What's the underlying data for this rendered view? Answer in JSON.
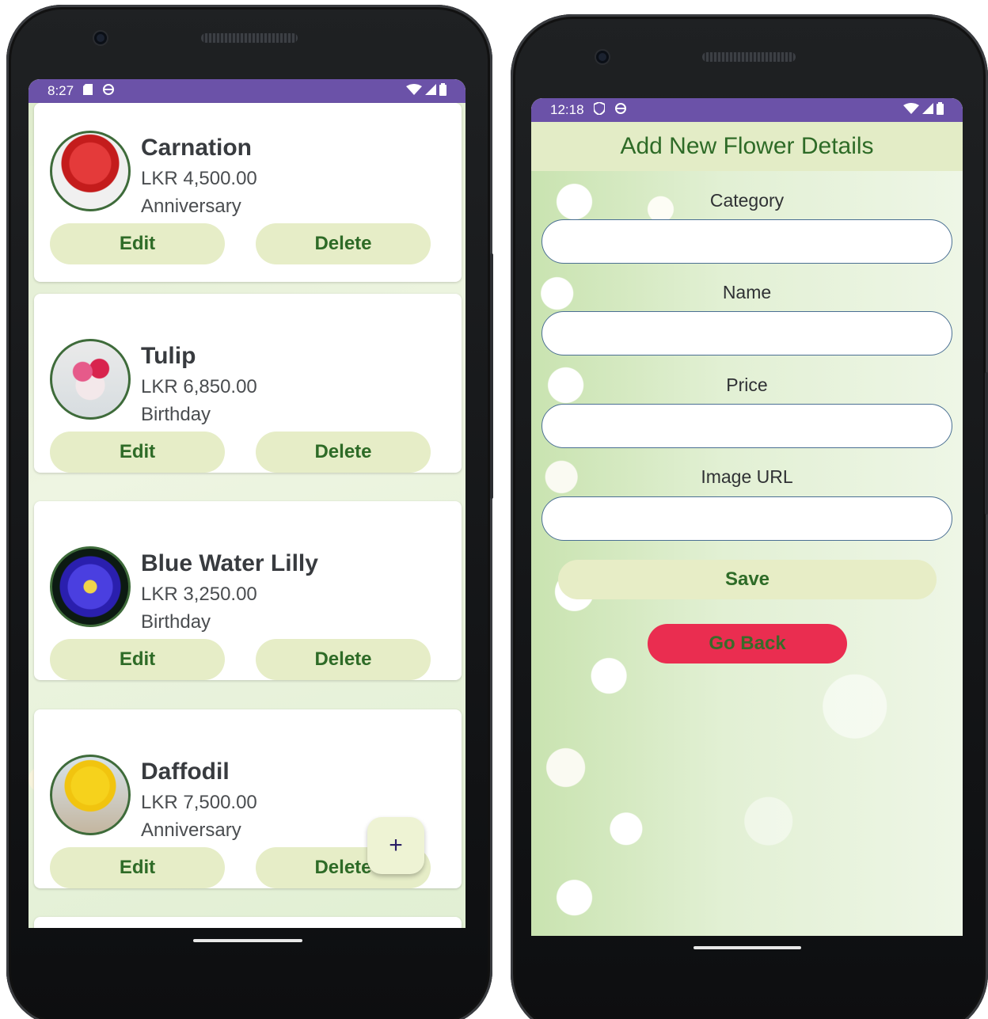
{
  "left_screen": {
    "status_bar": {
      "time": "8:27"
    },
    "flowers": [
      {
        "name": "Carnation",
        "price": "LKR 4,500.00",
        "category": "Anniversary"
      },
      {
        "name": "Tulip",
        "price": "LKR 6,850.00",
        "category": "Birthday"
      },
      {
        "name": "Blue Water Lilly",
        "price": "LKR 3,250.00",
        "category": "Birthday"
      },
      {
        "name": "Daffodil",
        "price": "LKR 7,500.00",
        "category": "Anniversary"
      }
    ],
    "edit_label": "Edit",
    "delete_label": "Delete",
    "fab_label": "+"
  },
  "right_screen": {
    "status_bar": {
      "time": "12:18"
    },
    "title": "Add New Flower Details",
    "fields": [
      {
        "label": "Category",
        "value": ""
      },
      {
        "label": "Name",
        "value": ""
      },
      {
        "label": "Price",
        "value": ""
      },
      {
        "label": "Image URL",
        "value": ""
      }
    ],
    "save_label": "Save",
    "back_label": "Go Back"
  },
  "colors": {
    "status_bar": "#6b52a8",
    "button_bg": "#e6edc7",
    "button_text": "#2e6b27",
    "go_back_bg": "#ea2d50",
    "header_bg": "#e3ecc6"
  }
}
